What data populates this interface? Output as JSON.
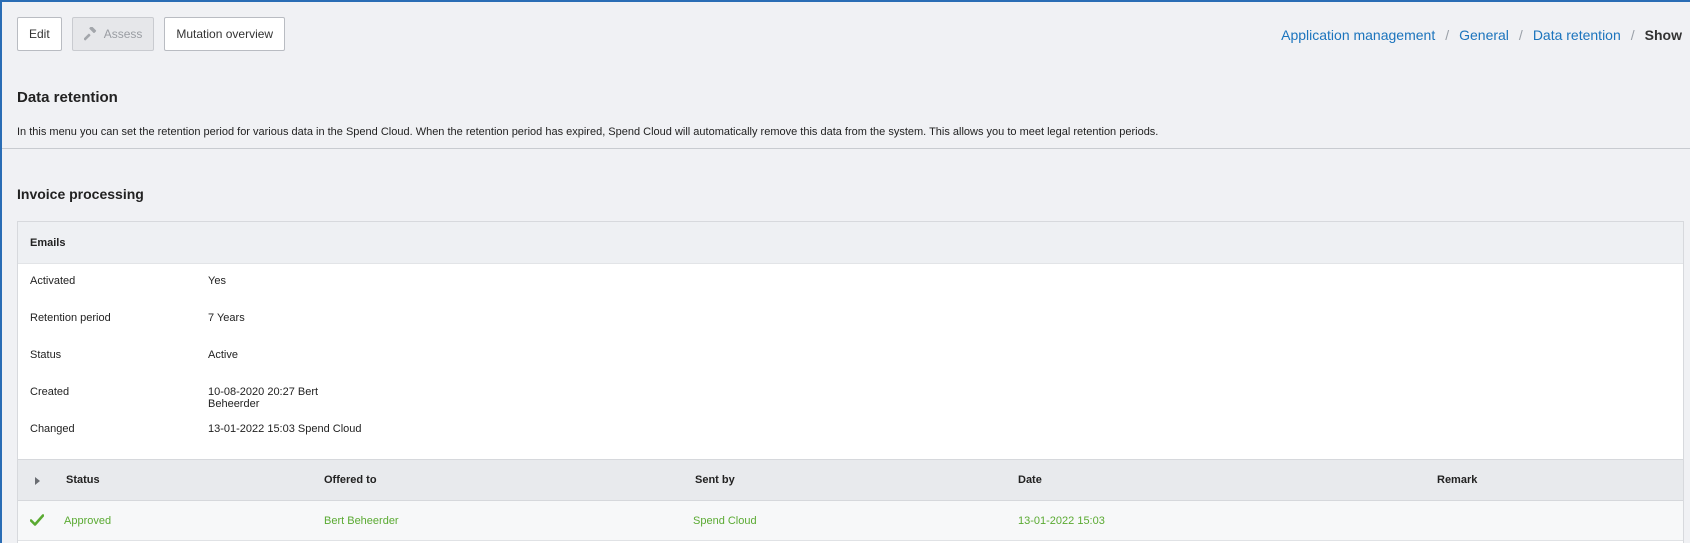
{
  "toolbar": {
    "edit_label": "Edit",
    "assess_label": "Assess",
    "assess_icon": "gavel-icon",
    "mutation_label": "Mutation overview"
  },
  "breadcrumb": {
    "items": [
      "Application management",
      "General",
      "Data retention"
    ],
    "current": "Show"
  },
  "page": {
    "title": "Data retention",
    "description": "In this menu you can set the retention period for various data in the Spend Cloud. When the retention period has expired, Spend Cloud will automatically remove this data from the system. This allows you to meet legal retention periods."
  },
  "section": {
    "title": "Invoice processing"
  },
  "panel": {
    "title": "Emails",
    "details": [
      {
        "label": "Activated",
        "value": "Yes"
      },
      {
        "label": "Retention period",
        "value": "7 Years"
      },
      {
        "label": "Status",
        "value": "Active"
      },
      {
        "label": "Created",
        "value": "10-08-2020 20:27 Bert Beheerder"
      },
      {
        "label": "Changed",
        "value": "13-01-2022 15:03 Spend Cloud"
      }
    ]
  },
  "history": {
    "columns": [
      "Status",
      "Offered to",
      "Sent by",
      "Date",
      "Remark"
    ],
    "rows": [
      {
        "status": "Approved",
        "offered_to": "Bert Beheerder",
        "sent_by": "Spend Cloud",
        "date": "13-01-2022 15:03",
        "remark": ""
      }
    ],
    "status_color": "#5aaa32"
  },
  "colors": {
    "accent": "#1b74bd",
    "frame_border": "#2a6db5",
    "approved": "#5aaa32"
  }
}
